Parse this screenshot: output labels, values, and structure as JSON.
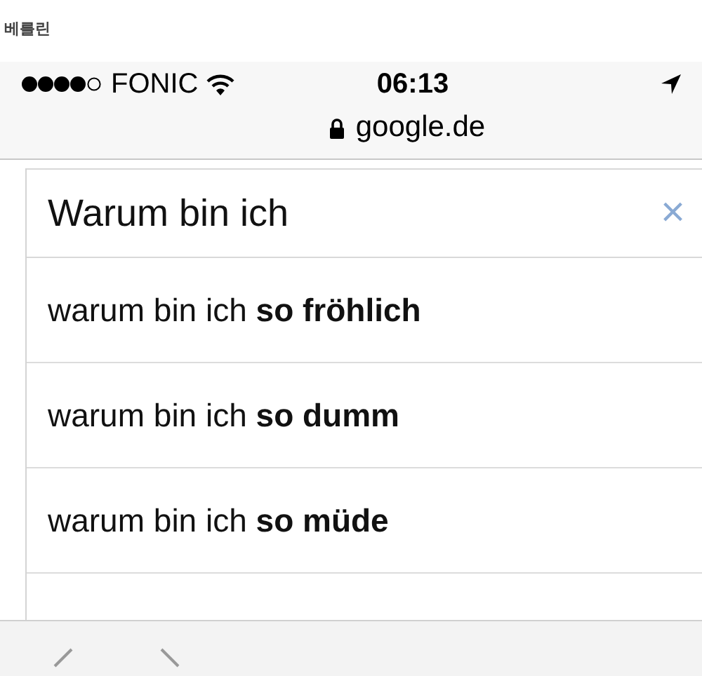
{
  "caption": "베를린",
  "status_bar": {
    "carrier": "FONIC",
    "time": "06:13"
  },
  "address_bar": {
    "url": "google.de"
  },
  "search": {
    "value": "Warum bin ich",
    "clear": "×"
  },
  "suggestions": [
    {
      "text": "warum bin ich **so fröhlich**"
    },
    {
      "text": "warum bin ich **so dumm**"
    },
    {
      "text": "warum bin ich **so müde**"
    }
  ]
}
